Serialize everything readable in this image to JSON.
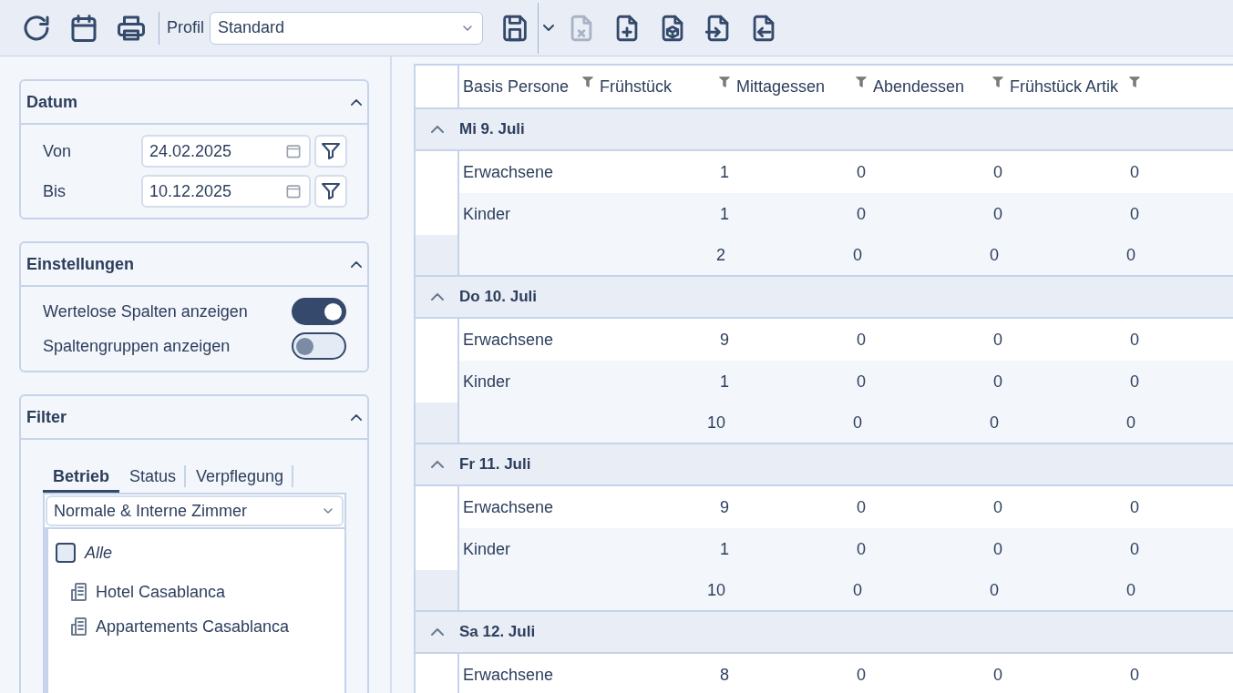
{
  "toolbar": {
    "left_buttons": [
      {
        "kind": "refresh",
        "disabled": false
      },
      {
        "kind": "calendar",
        "disabled": false
      },
      {
        "kind": "print",
        "disabled": false
      }
    ],
    "profile_label": "Profil",
    "profile_value": "Standard",
    "right_buttons": [
      {
        "kind": "save",
        "disabled": false
      },
      {
        "kind": "caret",
        "disabled": false
      },
      {
        "kind": "file-x",
        "disabled": true
      },
      {
        "kind": "file-plus",
        "disabled": false
      },
      {
        "kind": "file-cube",
        "disabled": false
      },
      {
        "kind": "file-in",
        "disabled": false
      },
      {
        "kind": "file-out",
        "disabled": false
      }
    ]
  },
  "sidebar": {
    "datum": {
      "title": "Datum",
      "expanded": true,
      "fields": [
        {
          "label": "Von",
          "value": "24.02.2025"
        },
        {
          "label": "Bis",
          "value": "10.12.2025"
        }
      ]
    },
    "einstellungen": {
      "title": "Einstellungen",
      "expanded": true,
      "toggles": [
        {
          "label": "Wertelose Spalten anzeigen",
          "on": true
        },
        {
          "label": "Spaltengruppen anzeigen",
          "on": false
        }
      ]
    },
    "filter": {
      "title": "Filter",
      "expanded": true,
      "tabs": [
        {
          "label": "Betrieb",
          "selected": true
        },
        {
          "label": "Status",
          "selected": false
        },
        {
          "label": "Verpflegung",
          "selected": false
        }
      ],
      "select": "Normale & Interne Zimmer",
      "all": {
        "label": "Alle",
        "checked": false
      },
      "items": [
        "Hotel Casablanca",
        "Appartements Casablanca"
      ]
    }
  },
  "table": {
    "columns": [
      "Basis Persone",
      "Frühstück",
      "Mittagessen",
      "Abendessen",
      "Frühstück Artik"
    ],
    "groups": [
      {
        "title": "Mi 9. Juli",
        "expanded": true,
        "rows": [
          {
            "kind": "data",
            "label": "Erwachsene",
            "values": [
              "1",
              "0",
              "0",
              "0"
            ]
          },
          {
            "kind": "data",
            "label": "Kinder",
            "values": [
              "1",
              "0",
              "0",
              "0"
            ]
          },
          {
            "kind": "total",
            "values": [
              "2",
              "0",
              "0",
              "0"
            ]
          }
        ]
      },
      {
        "title": "Do 10. Juli",
        "expanded": true,
        "rows": [
          {
            "kind": "data",
            "label": "Erwachsene",
            "values": [
              "9",
              "0",
              "0",
              "0"
            ]
          },
          {
            "kind": "data",
            "label": "Kinder",
            "values": [
              "1",
              "0",
              "0",
              "0"
            ]
          },
          {
            "kind": "total",
            "values": [
              "10",
              "0",
              "0",
              "0"
            ]
          }
        ]
      },
      {
        "title": "Fr 11. Juli",
        "expanded": true,
        "rows": [
          {
            "kind": "data",
            "label": "Erwachsene",
            "values": [
              "9",
              "0",
              "0",
              "0"
            ]
          },
          {
            "kind": "data",
            "label": "Kinder",
            "values": [
              "1",
              "0",
              "0",
              "0"
            ]
          },
          {
            "kind": "total",
            "values": [
              "10",
              "0",
              "0",
              "0"
            ]
          }
        ]
      },
      {
        "title": "Sa 12. Juli",
        "expanded": true,
        "rows": [
          {
            "kind": "data",
            "label": "Erwachsene",
            "values": [
              "8",
              "0",
              "0",
              "0"
            ]
          }
        ]
      }
    ]
  }
}
